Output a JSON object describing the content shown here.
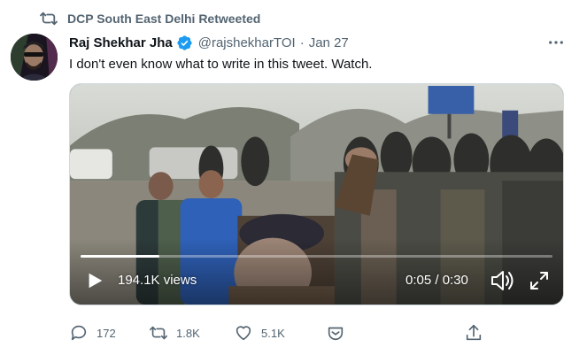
{
  "retweet_context": {
    "label": "DCP South East Delhi Retweeted",
    "icon": "retweet-icon"
  },
  "author": {
    "name": "Raj Shekhar Jha",
    "handle": "@rajshekharTOI",
    "separator": "·",
    "date": "Jan 27",
    "verified": true
  },
  "tweet": {
    "text": "I don't even know what to write in this tweet. Watch."
  },
  "video": {
    "views": "194.1K views",
    "time": "0:05 / 0:30",
    "progress": 0.167,
    "controls": [
      "play-icon",
      "volume-icon",
      "fullscreen-icon"
    ]
  },
  "actions": {
    "replies": "172",
    "retweets": "1.8K",
    "likes": "5.1K"
  },
  "colors": {
    "secondary_text": "#536471",
    "verified_blue": "#1d9bf0",
    "primary_text": "#0f1419"
  }
}
